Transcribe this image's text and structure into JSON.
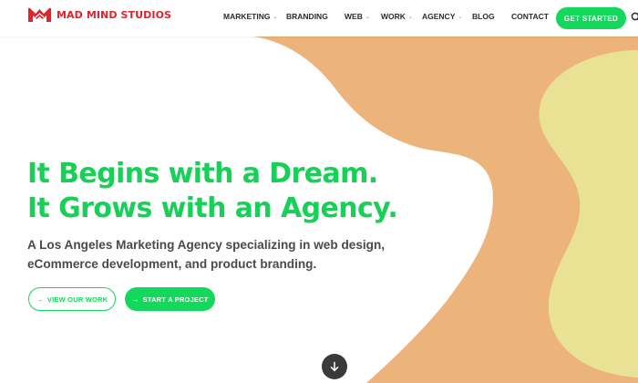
{
  "brand": {
    "name": "MAD MIND STUDIOS",
    "color": "#e2232d"
  },
  "nav": {
    "items": [
      {
        "label": "MARKETING",
        "has_dropdown": true
      },
      {
        "label": "BRANDING",
        "has_dropdown": false
      },
      {
        "label": "WEB",
        "has_dropdown": true
      },
      {
        "label": "WORK",
        "has_dropdown": true
      },
      {
        "label": "AGENCY",
        "has_dropdown": true
      },
      {
        "label": "BLOG",
        "has_dropdown": false
      },
      {
        "label": "CONTACT",
        "has_dropdown": false
      }
    ],
    "cta_label": "GET STARTED",
    "caret_glyph": "⌄",
    "search_icon": "search-icon"
  },
  "hero": {
    "headline_line1": "It Begins with a Dream.",
    "headline_line2": "It Grows with an Agency.",
    "subtitle_line1": "A Los Angeles Marketing Agency specializing in web design,",
    "subtitle_line2": "eCommerce development, and product branding.",
    "primary_button": "VIEW OUR WORK",
    "secondary_button": "START A PROJECT",
    "button_arrow": "→",
    "scroll_icon": "arrow-down-icon"
  },
  "colors": {
    "accent_green": "#14d85b",
    "headline_green": "#18cf57",
    "blob_orange": "#ecb37a",
    "blob_yellow": "#e9e294",
    "text_dark": "#4a4a4a"
  }
}
